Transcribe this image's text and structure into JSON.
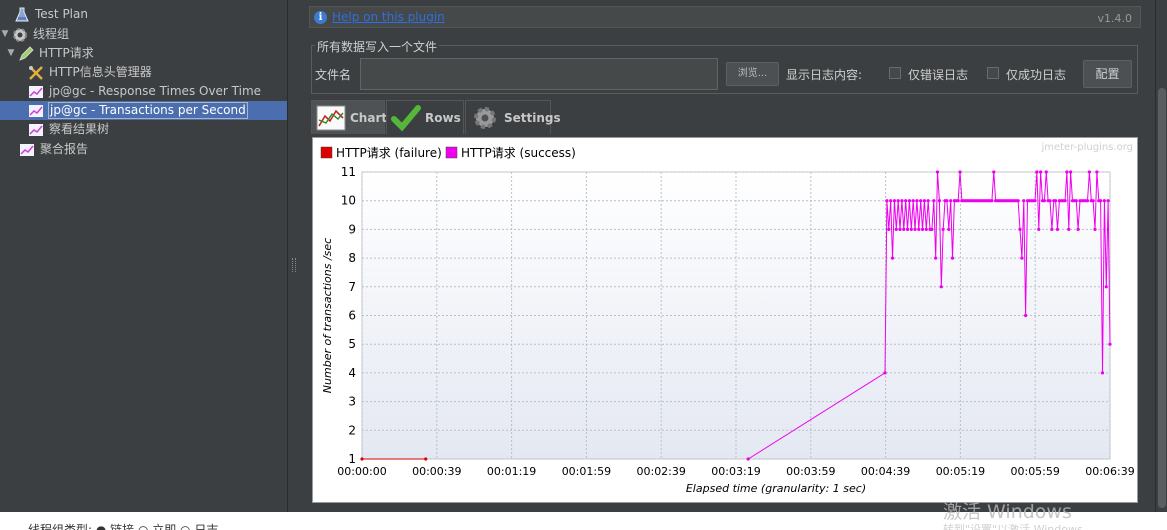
{
  "tree": {
    "items": [
      {
        "label": "Test Plan",
        "toggle": "",
        "icon": "flask-icon"
      },
      {
        "label": "线程组",
        "toggle": "▼",
        "icon": "gear-icon"
      },
      {
        "label": "HTTP请求",
        "toggle": "▼",
        "icon": "pen-icon"
      },
      {
        "label": "HTTP信息头管理器",
        "toggle": "",
        "icon": "wrench-icon"
      },
      {
        "label": "jp@gc - Response Times Over Time",
        "toggle": "",
        "icon": "graph-icon"
      },
      {
        "label": "jp@gc - Transactions per Second",
        "toggle": "",
        "icon": "graph-icon",
        "selected": true
      },
      {
        "label": "察看结果树",
        "toggle": "",
        "icon": "graph-icon"
      },
      {
        "label": "聚合报告",
        "toggle": "",
        "icon": "graph-icon"
      }
    ]
  },
  "help": {
    "link": "Help on this plugin",
    "version": "v1.4.0"
  },
  "file_group": {
    "legend": "所有数据写入一个文件",
    "file_label": "文件名",
    "file_value": "",
    "browse": "浏览...",
    "log_label": "显示日志内容:",
    "errors_only": "仅错误日志",
    "success_only": "仅成功日志",
    "config": "配置"
  },
  "tabs": [
    {
      "label": "Chart",
      "active": true
    },
    {
      "label": "Rows",
      "active": false
    },
    {
      "label": "Settings",
      "active": false
    }
  ],
  "colors": {
    "failure": "#dd0000",
    "success": "#ee00ee"
  },
  "chart_data": {
    "type": "line",
    "watermark": "jmeter-plugins.org",
    "xlabel": "Elapsed time (granularity: 1 sec)",
    "ylabel": "Number of transactions /sec",
    "xlim": [
      0,
      399
    ],
    "ylim": [
      1,
      11
    ],
    "x_ticks": [
      "00:00:00",
      "00:00:39",
      "00:01:19",
      "00:01:59",
      "00:02:39",
      "00:03:19",
      "00:03:59",
      "00:04:39",
      "00:05:19",
      "00:05:59",
      "00:06:39"
    ],
    "y_ticks": [
      1,
      2,
      3,
      4,
      5,
      6,
      7,
      8,
      9,
      10,
      11
    ],
    "grid": true,
    "legend": "top-left",
    "series": [
      {
        "name": "HTTP请求 (failure)",
        "color": "#dd0000",
        "x": [
          0,
          34
        ],
        "y": [
          1,
          1
        ]
      },
      {
        "name": "HTTP请求 (success)",
        "color": "#ee00ee",
        "x": [
          206,
          279,
          280,
          281,
          282,
          283,
          284,
          285,
          286,
          287,
          288,
          289,
          290,
          291,
          292,
          293,
          294,
          295,
          296,
          297,
          298,
          299,
          300,
          301,
          302,
          303,
          304,
          305,
          306,
          307,
          308,
          309,
          310,
          311,
          312,
          313,
          314,
          315,
          316,
          317,
          318,
          319,
          320,
          321,
          322,
          323,
          324,
          325,
          326,
          327,
          328,
          329,
          330,
          331,
          332,
          333,
          334,
          335,
          336,
          337,
          338,
          339,
          340,
          341,
          342,
          343,
          344,
          345,
          346,
          347,
          348,
          349,
          350,
          351,
          352,
          353,
          354,
          355,
          356,
          357,
          358,
          359,
          360,
          361,
          362,
          363,
          364,
          365,
          366,
          367,
          368,
          369,
          370,
          371,
          372,
          373,
          374,
          375,
          376,
          377,
          378,
          379,
          380,
          381,
          382,
          383,
          384,
          385,
          386,
          387,
          388,
          389,
          390,
          391,
          392,
          393,
          394,
          395,
          396,
          397,
          398,
          399
        ],
        "y": [
          1,
          4,
          10,
          9,
          10,
          8,
          10,
          9,
          10,
          9,
          10,
          9,
          10,
          9,
          10,
          9,
          10,
          9,
          10,
          9,
          10,
          9,
          10,
          9,
          10,
          9,
          9,
          10,
          8,
          11,
          10,
          7,
          9,
          10,
          10,
          9,
          10,
          8,
          10,
          10,
          10,
          11,
          10,
          10,
          10,
          10,
          10,
          10,
          10,
          10,
          10,
          10,
          10,
          10,
          10,
          10,
          10,
          10,
          10,
          11,
          10,
          10,
          10,
          10,
          10,
          10,
          10,
          10,
          10,
          10,
          10,
          10,
          10,
          9,
          8,
          10,
          6,
          10,
          10,
          10,
          10,
          10,
          11,
          9,
          11,
          10,
          10,
          11,
          10,
          10,
          9,
          10,
          10,
          9,
          10,
          10,
          10,
          10,
          11,
          9,
          11,
          10,
          10,
          10,
          9,
          10,
          10,
          10,
          10,
          10,
          11,
          10,
          10,
          9,
          11,
          10,
          10,
          4,
          10,
          7,
          10,
          5
        ]
      }
    ]
  },
  "bottom": {
    "text": "线程组类型: ● 链接 ○ 立即 ○ 日志"
  },
  "watermark": {
    "line1": "激活 Windows",
    "line2": "转到\"设置\"以激活 Windows。"
  }
}
